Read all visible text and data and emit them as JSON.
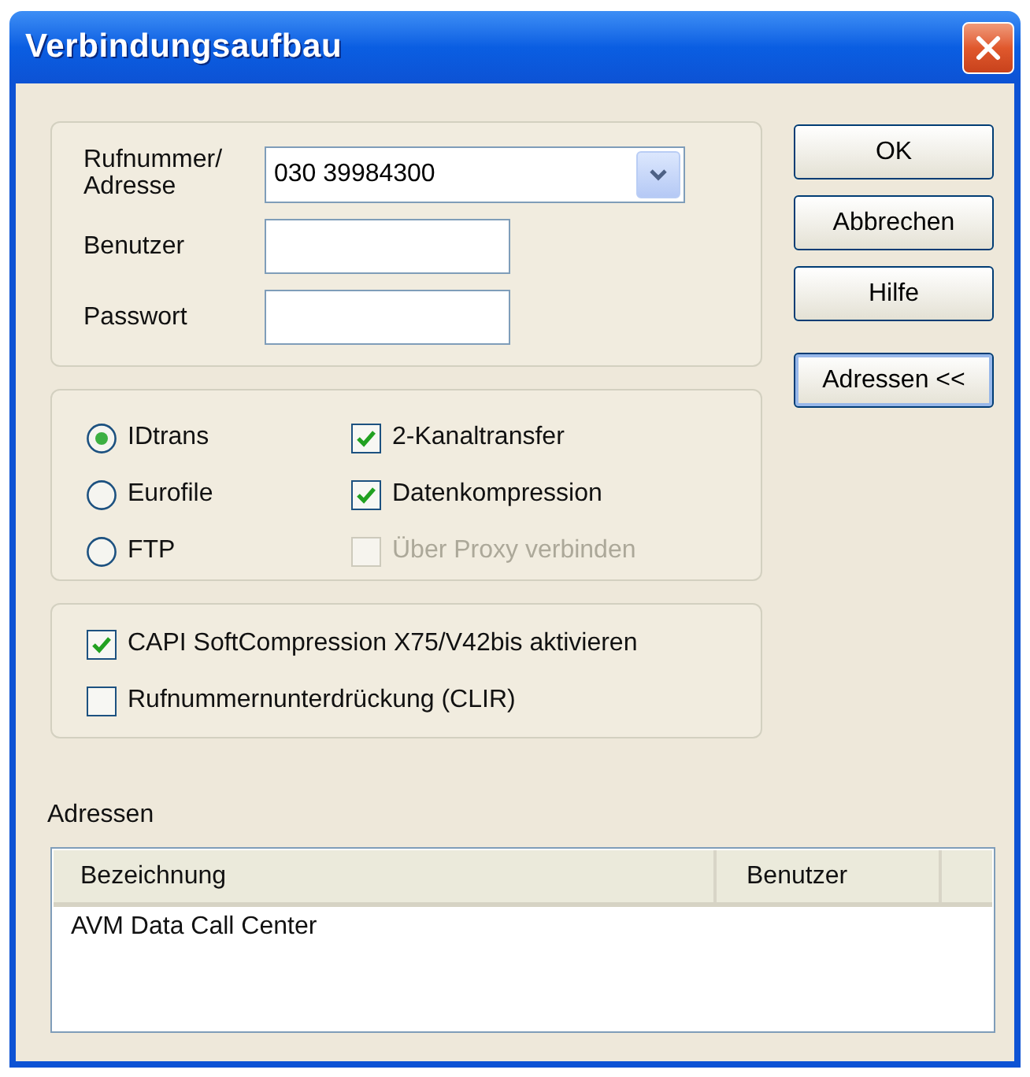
{
  "window": {
    "title": "Verbindungsaufbau"
  },
  "connection": {
    "fields": [
      {
        "kind": "combo",
        "label": "Rufnummer/ Adresse",
        "value": "030 39984300"
      },
      {
        "kind": "text",
        "label": "Benutzer"
      },
      {
        "kind": "password",
        "label": "Passwort"
      }
    ]
  },
  "buttons": [
    {
      "label": "OK"
    },
    {
      "label": "Abbrechen"
    },
    {
      "label": "Hilfe"
    },
    {
      "label": "Adressen <<"
    }
  ],
  "protocols": [
    {
      "label": "IDtrans",
      "selected": true
    },
    {
      "label": "Eurofile",
      "selected": false
    },
    {
      "label": "FTP",
      "selected": false
    }
  ],
  "transfer_options": [
    {
      "label": "2-Kanaltransfer",
      "checked": true,
      "disabled": false
    },
    {
      "label": "Datenkompression",
      "checked": true,
      "disabled": false
    },
    {
      "label": "Über Proxy verbinden",
      "checked": false,
      "disabled": true
    }
  ],
  "capi_options": [
    {
      "label": "CAPI SoftCompression X75/V42bis aktivieren",
      "checked": true
    },
    {
      "label": "Rufnummernunterdrückung (CLIR)",
      "checked": false
    }
  ],
  "addresses": {
    "label": "Adressen",
    "columns": [
      "Bezeichnung",
      "Benutzer"
    ],
    "rows": [
      {
        "cells": [
          "AVM Data Call Center"
        ]
      }
    ]
  }
}
